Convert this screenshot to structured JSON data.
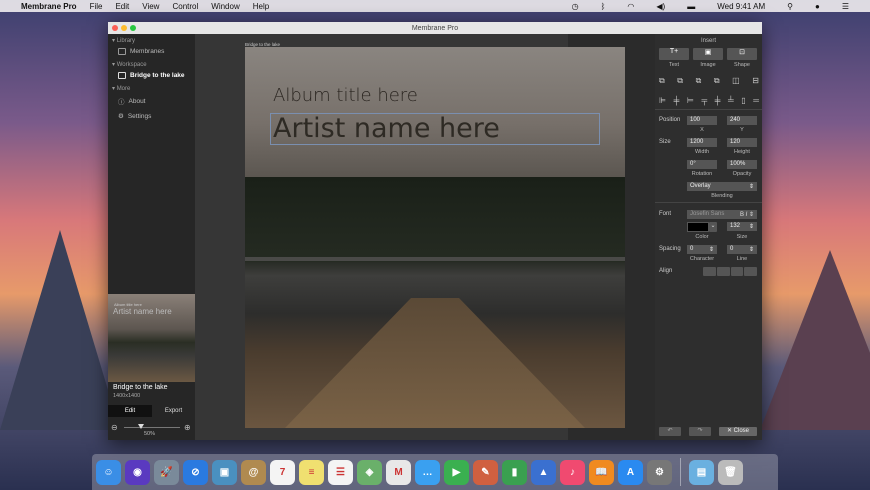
{
  "menubar": {
    "app": "Membrane Pro",
    "menus": [
      "File",
      "Edit",
      "View",
      "Control",
      "Window",
      "Help"
    ],
    "clock": "Wed 9:41 AM"
  },
  "window": {
    "title": "Membrane Pro"
  },
  "sidebar": {
    "sections": [
      {
        "label": "Library",
        "items": [
          {
            "label": "Membranes",
            "icon": "membranes-icon"
          }
        ]
      },
      {
        "label": "Workspace",
        "items": [
          {
            "label": "Bridge to the lake",
            "icon": "image-icon",
            "selected": true
          }
        ]
      },
      {
        "label": "More",
        "items": [
          {
            "label": "About",
            "icon": "info-icon"
          },
          {
            "label": "Settings",
            "icon": "gear-icon"
          }
        ]
      }
    ],
    "preview": {
      "name": "Bridge to the lake",
      "dims": "1400x1400"
    },
    "tabs": {
      "edit": "Edit",
      "export": "Export"
    },
    "zoom": {
      "value": "50%",
      "fraction": 0.3
    }
  },
  "canvas": {
    "doc_label": "Bridge to the lake",
    "album_title": "Album title here",
    "artist": "Artist name here"
  },
  "panel": {
    "insert": "Insert",
    "text": "Text",
    "image": "Image",
    "shape": "Shape",
    "position": "Position",
    "x": "100",
    "y": "240",
    "x_label": "X",
    "y_label": "Y",
    "size": "Size",
    "width": "1200",
    "height": "120",
    "width_label": "Width",
    "height_label": "Height",
    "rotation": "0°",
    "opacity": "100%",
    "rotation_label": "Rotation",
    "opacity_label": "Opacity",
    "blending": "Overlay",
    "blending_label": "Blending",
    "font": "Font",
    "font_name": "Josefin Sans",
    "bold": "B",
    "italic": "I",
    "color_label": "Color",
    "size_value": "132",
    "size_label": "Size",
    "spacing": "Spacing",
    "character": "0",
    "line": "0",
    "character_label": "Character",
    "line_label": "Line",
    "align": "Align",
    "close": "Close",
    "color": "#000000"
  },
  "dock": [
    {
      "name": "finder",
      "color": "#3a8ee6",
      "glyph": "☺"
    },
    {
      "name": "siri",
      "color": "#5a3ac0",
      "glyph": "◉"
    },
    {
      "name": "launchpad",
      "color": "#7a8a9a",
      "glyph": "🚀"
    },
    {
      "name": "safari",
      "color": "#2a7ae0",
      "glyph": "⊘"
    },
    {
      "name": "photos-preview",
      "color": "#4a90c0",
      "glyph": "▣"
    },
    {
      "name": "contacts",
      "color": "#b08a50",
      "glyph": "@"
    },
    {
      "name": "calendar",
      "color": "#f4f4f4",
      "glyph": "7"
    },
    {
      "name": "notes",
      "color": "#f0e070",
      "glyph": "≡"
    },
    {
      "name": "reminders",
      "color": "#f4f4f4",
      "glyph": "☰"
    },
    {
      "name": "maps",
      "color": "#6ab06a",
      "glyph": "◈"
    },
    {
      "name": "membrane",
      "color": "#e8e8e8",
      "glyph": "M"
    },
    {
      "name": "messages",
      "color": "#3aa0f0",
      "glyph": "…"
    },
    {
      "name": "facetime",
      "color": "#3ab050",
      "glyph": "▶"
    },
    {
      "name": "photo-booth",
      "color": "#d06040",
      "glyph": "✎"
    },
    {
      "name": "numbers",
      "color": "#3aa050",
      "glyph": "▮"
    },
    {
      "name": "keynote",
      "color": "#3a70d0",
      "glyph": "▲"
    },
    {
      "name": "itunes",
      "color": "#f04a70",
      "glyph": "♪"
    },
    {
      "name": "ibooks",
      "color": "#f08a20",
      "glyph": "📖"
    },
    {
      "name": "app-store",
      "color": "#2a8af0",
      "glyph": "A"
    },
    {
      "name": "system-preferences",
      "color": "#777",
      "glyph": "⚙"
    },
    {
      "name": "downloads-folder",
      "color": "#6ab0e0",
      "glyph": "▤"
    },
    {
      "name": "trash",
      "color": "#bbb",
      "glyph": "🗑"
    }
  ]
}
